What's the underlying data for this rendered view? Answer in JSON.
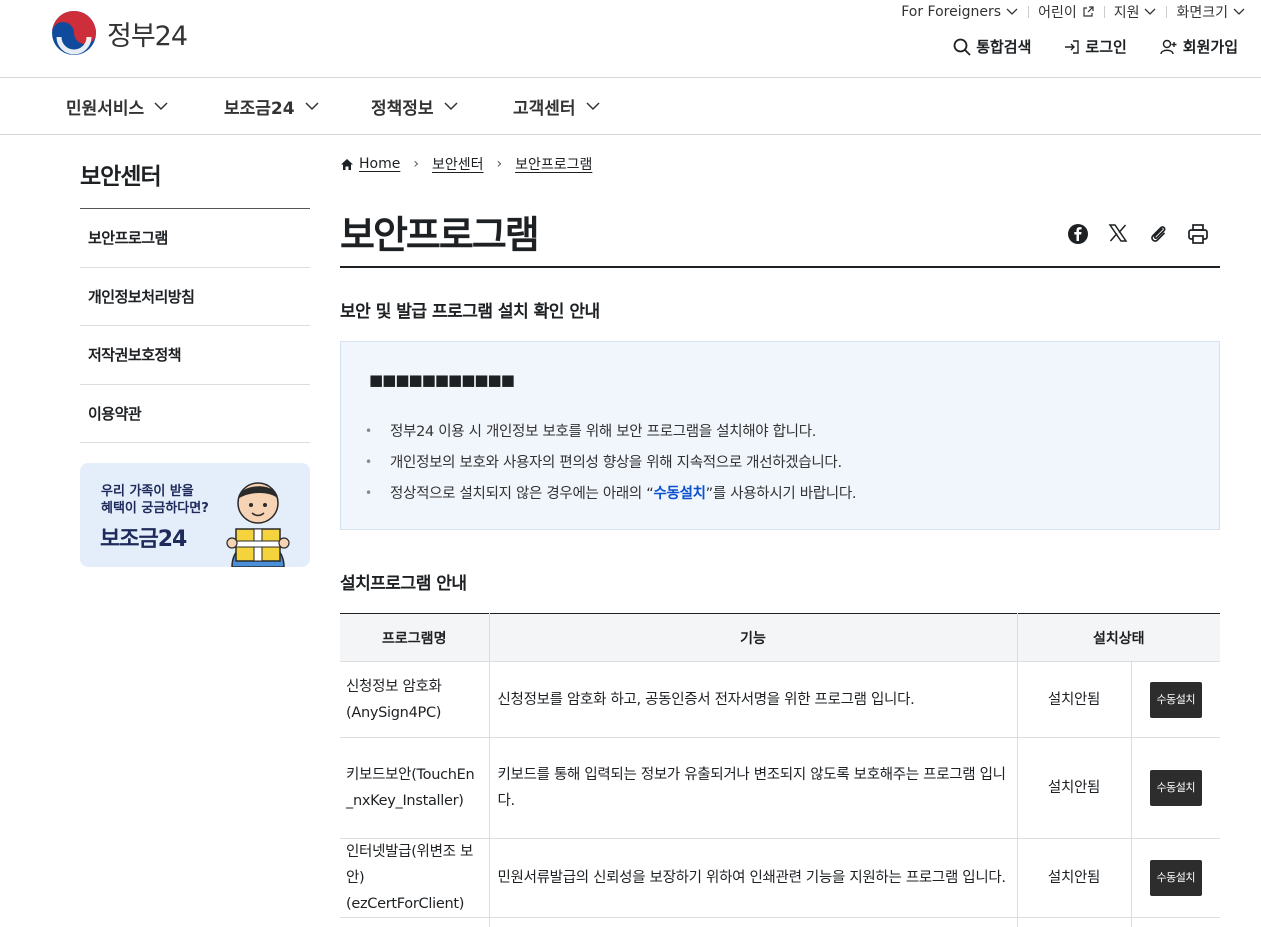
{
  "header": {
    "logo_text": "정부24",
    "util": {
      "foreigners": "For Foreigners",
      "kids": "어린이",
      "support": "지원",
      "font_size": "화면크기"
    },
    "actions": {
      "search": "통합검색",
      "login": "로그인",
      "signup": "회원가입"
    }
  },
  "gnb": {
    "items": [
      {
        "label": "민원서비스"
      },
      {
        "label": "보조금24"
      },
      {
        "label": "정책정보"
      },
      {
        "label": "고객센터"
      }
    ]
  },
  "sidebar": {
    "title": "보안센터",
    "items": [
      {
        "label": "보안프로그램"
      },
      {
        "label": "개인정보처리방침"
      },
      {
        "label": "저작권보호정책"
      },
      {
        "label": "이용약관"
      }
    ],
    "banner": {
      "line1": "우리 가족이 받을",
      "line2": "혜택이 궁금하다면?",
      "title": "보조금24"
    }
  },
  "breadcrumb": {
    "home": "Home",
    "level1": "보안센터",
    "level2": "보안프로그램"
  },
  "page": {
    "title": "보안프로그램",
    "section1_title": "보안 및 발급 프로그램 설치 확인 안내",
    "masked_text": "■■■■■■■■■■■",
    "bullets": [
      "정부24 이용 시 개인정보 보호를 위해 보안 프로그램을 설치해야 합니다.",
      "개인정보의 보호와 사용자의 편의성 향상을 위해 지속적으로 개선하겠습니다."
    ],
    "bullet3": {
      "before": "정상적으로 설치되지 않은 경우에는 아래의 “",
      "highlight": "수동설치",
      "after": "”를 사용하시기 바랍니다."
    },
    "section2_title": "설치프로그램 안내"
  },
  "table": {
    "headers": [
      "프로그램명",
      "기능",
      "설치상태"
    ],
    "rows": [
      {
        "name": "신청정보 암호화(AnySign4PC)",
        "function": "신청정보를 암호화 하고, 공동인증서 전자서명을 위한 프로그램 입니다.",
        "status": "설치안됨",
        "button": "수동설치"
      },
      {
        "name": "키보드보안(TouchEn_nxKey_Installer)",
        "function": "키보드를 통해 입력되는 정보가 유출되거나 변조되지 않도록 보호해주는 프로그램 입니다.",
        "status": "설치안됨",
        "button": "수동설치"
      },
      {
        "name": "인터넷발급(위변조 보안)(ezCertForClient)",
        "function": "민원서류발급의 신뢰성을 보장하기 위하여 인쇄관련 기능을 지원하는 프로그램 입니다.",
        "status": "설치안됨",
        "button": "수동설치"
      }
    ]
  },
  "colors": {
    "accent_blue": "#0b50d0",
    "logo_red": "#cd2e3a",
    "logo_blue": "#0f4a9c",
    "info_bg": "#f0f6fc",
    "button_dark": "#2d2d2d"
  },
  "icons": [
    "search-icon",
    "login-icon",
    "signup-icon",
    "external-link-icon",
    "chevron-down-icon",
    "home-icon",
    "facebook-icon",
    "x-icon",
    "link-icon",
    "print-icon"
  ]
}
